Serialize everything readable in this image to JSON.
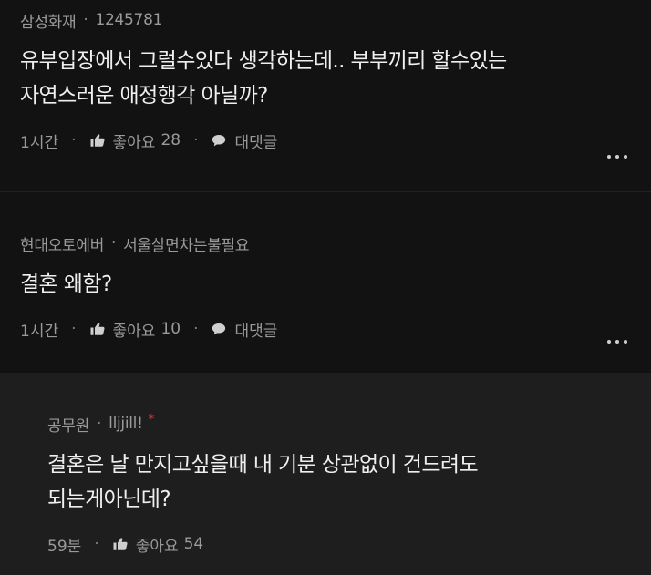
{
  "comments": [
    {
      "author": "삼성화재",
      "tag": "1245781",
      "text": "유부입장에서 그럴수있다 생각하는데.. 부부끼리 할수있는\n자연스러운 애정행각 아닐까?",
      "time": "1시간",
      "like_label": "좋아요",
      "like_count": "28",
      "reply_label": "대댓글"
    },
    {
      "author": "현대오토에버",
      "tag": "서울살면차는불필요",
      "text": "결혼 왜함?",
      "time": "1시간",
      "like_label": "좋아요",
      "like_count": "10",
      "reply_label": "대댓글"
    }
  ],
  "reply": {
    "author": "공무원",
    "tag": "lljjill!",
    "badge": "*",
    "text": "결혼은 날 만지고싶을때 내 기분 상관없이 건드려도\n되는게아닌데?",
    "time": "59분",
    "like_label": "좋아요",
    "like_count": "54"
  },
  "separator": "·",
  "icons": {
    "like": "thumbs-up-icon",
    "reply": "speech-bubble-icon",
    "more": "more-dots-icon"
  },
  "colors": {
    "background": "#121212",
    "reply_background": "#1e1e1e",
    "meta_text": "#9a9a9a",
    "body_text": "#efefef",
    "badge": "#e0453a"
  }
}
